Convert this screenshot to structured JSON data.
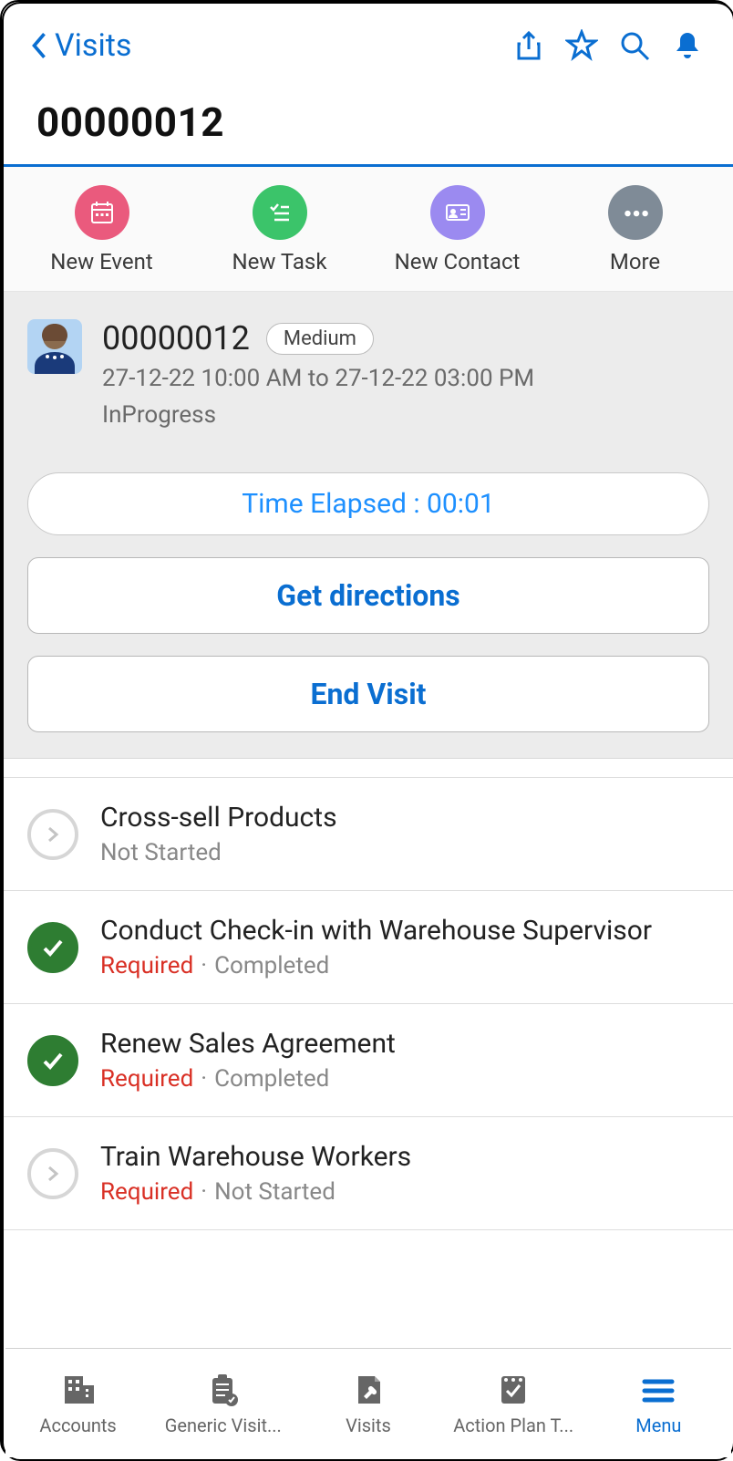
{
  "header": {
    "back_label": "Visits"
  },
  "title": "00000012",
  "quick_actions": [
    {
      "label": "New Event",
      "color": "#ea5a7d",
      "icon": "calendar"
    },
    {
      "label": "New Task",
      "color": "#3bc46a",
      "icon": "checklist"
    },
    {
      "label": "New Contact",
      "color": "#9b8af0",
      "icon": "contact-card"
    },
    {
      "label": "More",
      "color": "#7f8b97",
      "icon": "dots"
    }
  ],
  "record": {
    "id": "00000012",
    "priority": "Medium",
    "datetime": "27-12-22 10:00 AM to 27-12-22 03:00 PM",
    "status": "InProgress"
  },
  "actions": {
    "time_elapsed": "Time Elapsed : 00:01",
    "get_directions": "Get directions",
    "end_visit": "End Visit"
  },
  "tasks": [
    {
      "title": "Cross-sell Products",
      "required": false,
      "status": "Not Started",
      "completed": false
    },
    {
      "title": "Conduct Check-in with Warehouse Supervisor",
      "required": true,
      "status": "Completed",
      "completed": true
    },
    {
      "title": "Renew Sales Agreement",
      "required": true,
      "status": "Completed",
      "completed": true
    },
    {
      "title": "Train Warehouse Workers",
      "required": true,
      "status": "Not Started",
      "completed": false
    }
  ],
  "bottom_nav": [
    {
      "label": "Accounts",
      "icon": "building"
    },
    {
      "label": "Generic Visit...",
      "icon": "clipboard"
    },
    {
      "label": "Visits",
      "icon": "wrench-doc"
    },
    {
      "label": "Action Plan T...",
      "icon": "plan"
    },
    {
      "label": "Menu",
      "icon": "menu",
      "active": true
    }
  ],
  "strings": {
    "required_label": "Required"
  }
}
